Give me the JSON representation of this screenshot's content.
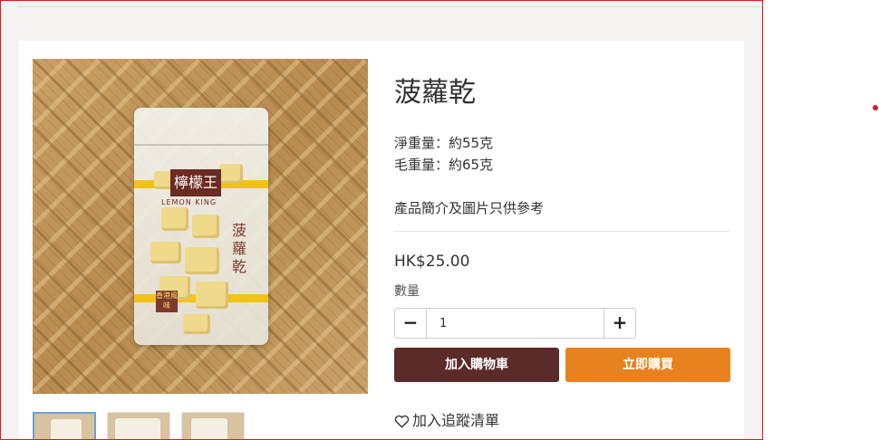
{
  "product": {
    "title": "菠蘿乾",
    "net_weight": "淨重量：約55克",
    "gross_weight": "毛重量：約65克",
    "note": "產品簡介及圖片只供參考",
    "price": "HK$25.00",
    "quantity_label": "數量",
    "quantity_value": "1",
    "minus_symbol": "−",
    "plus_symbol": "+"
  },
  "actions": {
    "add_to_cart": "加入購物車",
    "buy_now": "立即購買",
    "wishlist": "加入追蹤清單"
  },
  "image": {
    "brand_cn": "檸檬王",
    "brand_en": "LEMON KING",
    "package_name": "菠蘿乾",
    "stamp": "香港風味"
  },
  "thumbnails": [
    "product-photo-1",
    "product-photo-2",
    "product-photo-3"
  ],
  "colors": {
    "cart_button": "#5a2b29",
    "buy_button": "#e8821e",
    "frame_border": "#e0181b",
    "active_thumb": "#6aa0d8"
  },
  "icons": {
    "wishlist": "heart-outline-icon"
  }
}
